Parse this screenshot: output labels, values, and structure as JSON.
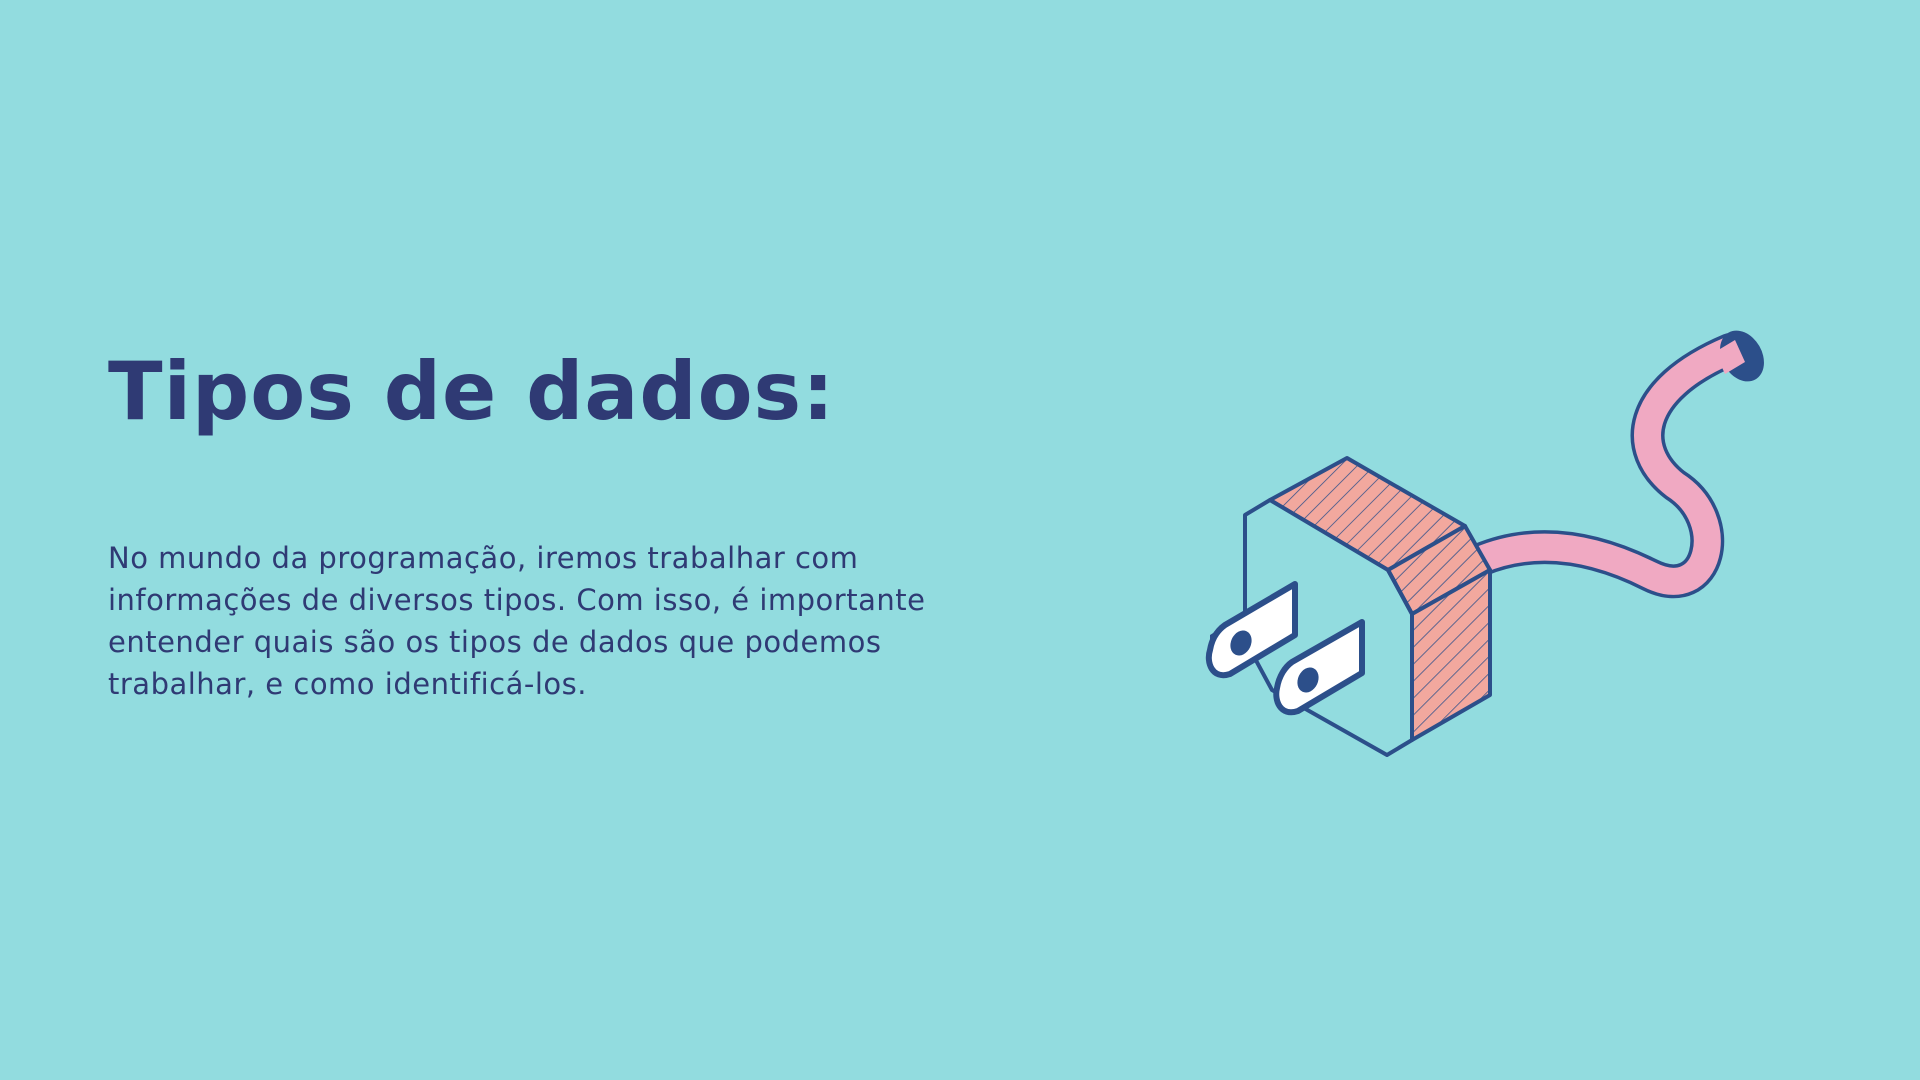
{
  "slide": {
    "title": "Tipos de dados:",
    "body": "No mundo da programação, iremos trabalhar com informações de diversos tipos. Com isso, é importante entender quais são os tipos de dados que podemos trabalhar, e como identificá-los.",
    "illustration_icon": "electric-plug-icon"
  },
  "colors": {
    "background": "#92dcdf",
    "text": "#2f3a74",
    "plug_stroke": "#2c4f8a",
    "plug_face": "#92dcdf",
    "plug_side": "#f2a89e",
    "cable": "#f0a9c2",
    "prong": "#ffffff"
  }
}
